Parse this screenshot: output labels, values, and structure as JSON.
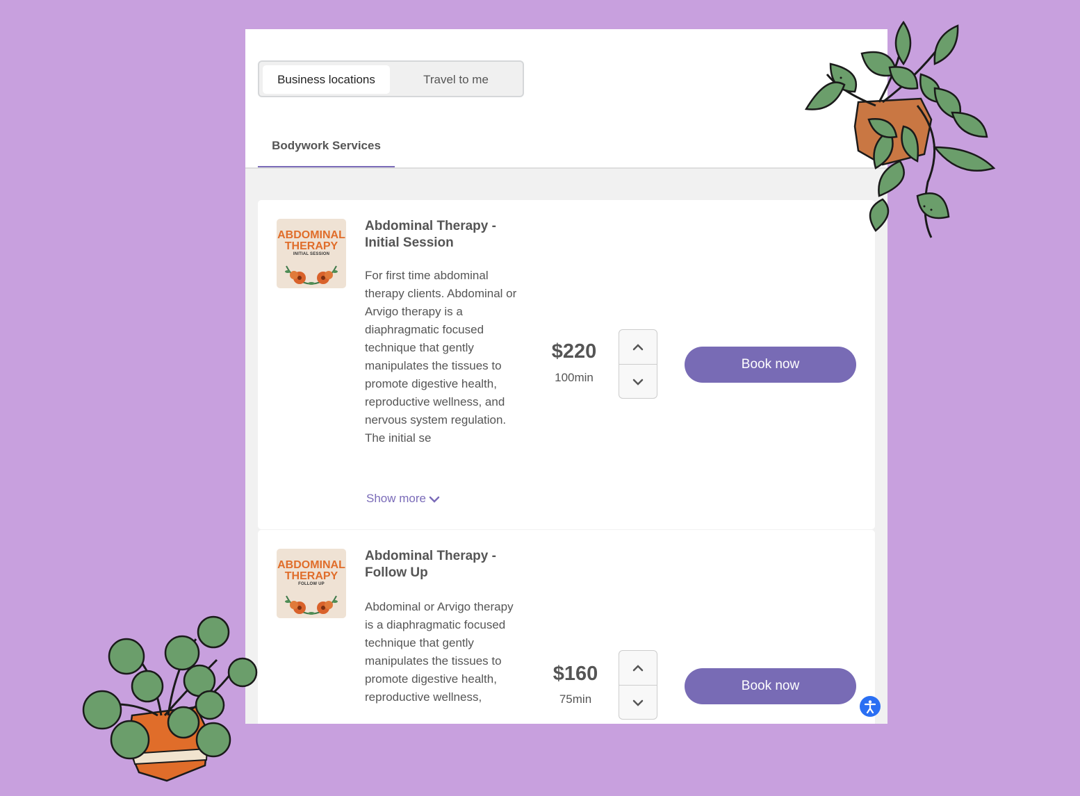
{
  "location_toggle": {
    "options": [
      "Business locations",
      "Travel to me"
    ],
    "selected": "Business locations"
  },
  "tabs": [
    {
      "label": "Bodywork Services",
      "active": true
    }
  ],
  "services": [
    {
      "thumb_title_1": "ABDOMINAL",
      "thumb_title_2": "THERAPY",
      "thumb_subtitle": "INITIAL SESSION",
      "title": "Abdominal Therapy - Initial Session",
      "description": "For first time abdominal therapy clients. Abdominal or Arvigo therapy is a diaphragmatic focused technique that gently manipulates the tissues to promote digestive health, reproductive wellness, and nervous system regulation. The initial se",
      "show_more": "Show more",
      "price": "$220",
      "duration": "100min",
      "book_label": "Book now"
    },
    {
      "thumb_title_1": "ABDOMINAL",
      "thumb_title_2": "THERAPY",
      "thumb_subtitle": "FOLLOW UP",
      "title": "Abdominal Therapy - Follow Up",
      "description": "Abdominal or Arvigo therapy is a diaphragmatic focused technique that gently manipulates the tissues to promote digestive health, reproductive wellness,",
      "price": "$160",
      "duration": "75min",
      "book_label": "Book now"
    }
  ],
  "colors": {
    "background": "#c8a0de",
    "accent": "#786bb5",
    "accessibility_button": "#2a6ff3"
  },
  "icons": [
    "chevron-up-icon",
    "chevron-down-icon",
    "accessibility-icon",
    "plant-illustration"
  ]
}
